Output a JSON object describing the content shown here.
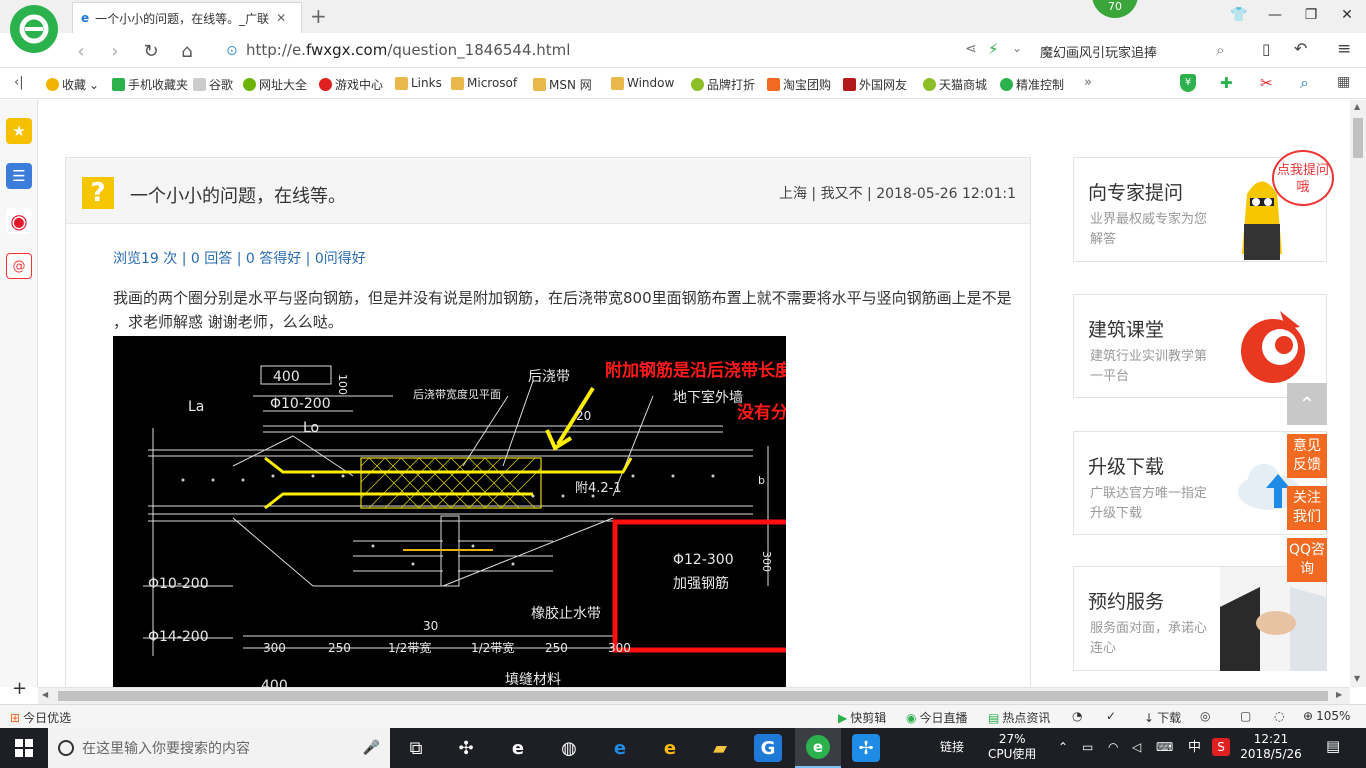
{
  "browser": {
    "tab_title": "一个小小的问题，在线等。_广联",
    "url_prefix": "http://e.",
    "url_domain": "fwxgx.com",
    "url_path": "/question_1846544.html",
    "search_text": "魔幻画风引玩家追捧",
    "badge_count": "70"
  },
  "bookmarks": [
    {
      "label": "收藏",
      "color": "#f0b400"
    },
    {
      "label": "手机收藏夹",
      "color": "#2bb24c"
    },
    {
      "label": "谷歌",
      "color": "#9a9a9a"
    },
    {
      "label": "网址大全",
      "color": "#6bb500"
    },
    {
      "label": "游戏中心",
      "color": "#e0201e"
    },
    {
      "label": "Links",
      "color": "#e8b84a"
    },
    {
      "label": "Microsof",
      "color": "#e8b84a"
    },
    {
      "label": "MSN 网",
      "color": "#e8b84a"
    },
    {
      "label": "Window",
      "color": "#e8b84a"
    },
    {
      "label": "品牌打折",
      "color": "#8cbf26"
    },
    {
      "label": "淘宝团购",
      "color": "#f26a21"
    },
    {
      "label": "外国网友",
      "color": "#b3181a"
    },
    {
      "label": "天猫商城",
      "color": "#8cbf26"
    },
    {
      "label": "精准控制",
      "color": "#2bb24c"
    }
  ],
  "question": {
    "title": "一个小小的问题，在线等。",
    "meta": "上海 | 我又不 | 2018-05-26 12:01:1",
    "stats": "浏览19 次 | 0 回答 | 0 答得好 | 0问得好",
    "body": "我画的两个圈分别是水平与竖向钢筋，但是并没有说是附加钢筋，在后浇带宽800里面钢筋布置上就不需要将水平与竖向钢筋画上是不是 ，求老师解惑  谢谢老师，么么哒。"
  },
  "cad": {
    "annotation_line1": "附加钢筋是沿后浇带长度方向布置的",
    "annotation_line2": "没有分布钢筋",
    "labels": [
      "400",
      "100",
      "后浇带",
      "后浇带宽度见平面",
      "La",
      "Φ10-200",
      "Lo",
      "20",
      "地下室外墙",
      "附4.2-1",
      "Φ12-300",
      "加强钢筋",
      "300",
      "Φ10-200",
      "Φ14-200",
      "300",
      "250",
      "1/2带宽",
      "1/2带宽",
      "250",
      "300",
      "30",
      "橡胶止水带",
      "填缝材料",
      "400",
      "b"
    ]
  },
  "sidebar_cards": [
    {
      "title": "向专家提问",
      "sub": "业界最权威专家为您解答",
      "bubble": "点我提问哦"
    },
    {
      "title": "建筑课堂",
      "sub": "建筑行业实训教学第一平台"
    },
    {
      "title": "升级下载",
      "sub": "广联达官方唯一指定升级下载"
    },
    {
      "title": "预约服务",
      "sub": "服务面对面，承诺心连心"
    }
  ],
  "float_buttons": [
    "意见反馈",
    "关注我们",
    "QQ咨询"
  ],
  "statusbar": {
    "left": "今日优选",
    "items": [
      "快剪辑",
      "今日直播",
      "热点资讯",
      "下载"
    ],
    "zoom": "105%"
  },
  "taskbar": {
    "search_placeholder": "在这里输入你要搜索的内容",
    "link_label": "链接",
    "cpu_percent": "27%",
    "cpu_label": "CPU使用",
    "ime": "中",
    "time": "12:21",
    "date": "2018/5/26"
  }
}
